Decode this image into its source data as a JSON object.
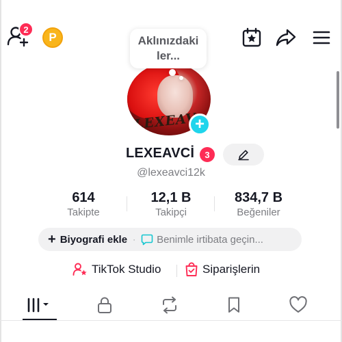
{
  "header": {
    "friends_badge_count": "2",
    "coin_letter": "P"
  },
  "note": {
    "text": "Aklınızdaki ler..."
  },
  "avatar": {
    "overlay_text": "LEXEAV"
  },
  "profile": {
    "username": "LEXEAVCİ",
    "username_badge": "3",
    "handle": "@lexeavci12k"
  },
  "stats": [
    {
      "value": "614",
      "label": "Takipte"
    },
    {
      "value": "12,1 B",
      "label": "Takipçi"
    },
    {
      "value": "834,7 B",
      "label": "Beğeniler"
    }
  ],
  "bio": {
    "add_label": "Biyografi ekle",
    "separator": "·",
    "contact_label": "Benimle irtibata geçin..."
  },
  "links": {
    "studio_label": "TikTok Studio",
    "orders_label": "Siparişlerin"
  },
  "tabs": [
    "videos",
    "private",
    "reposts",
    "favorites",
    "liked"
  ],
  "colors": {
    "accent_red": "#fe2c55",
    "accent_cyan": "#20d5ec",
    "coin_gold": "#f9b51b"
  }
}
